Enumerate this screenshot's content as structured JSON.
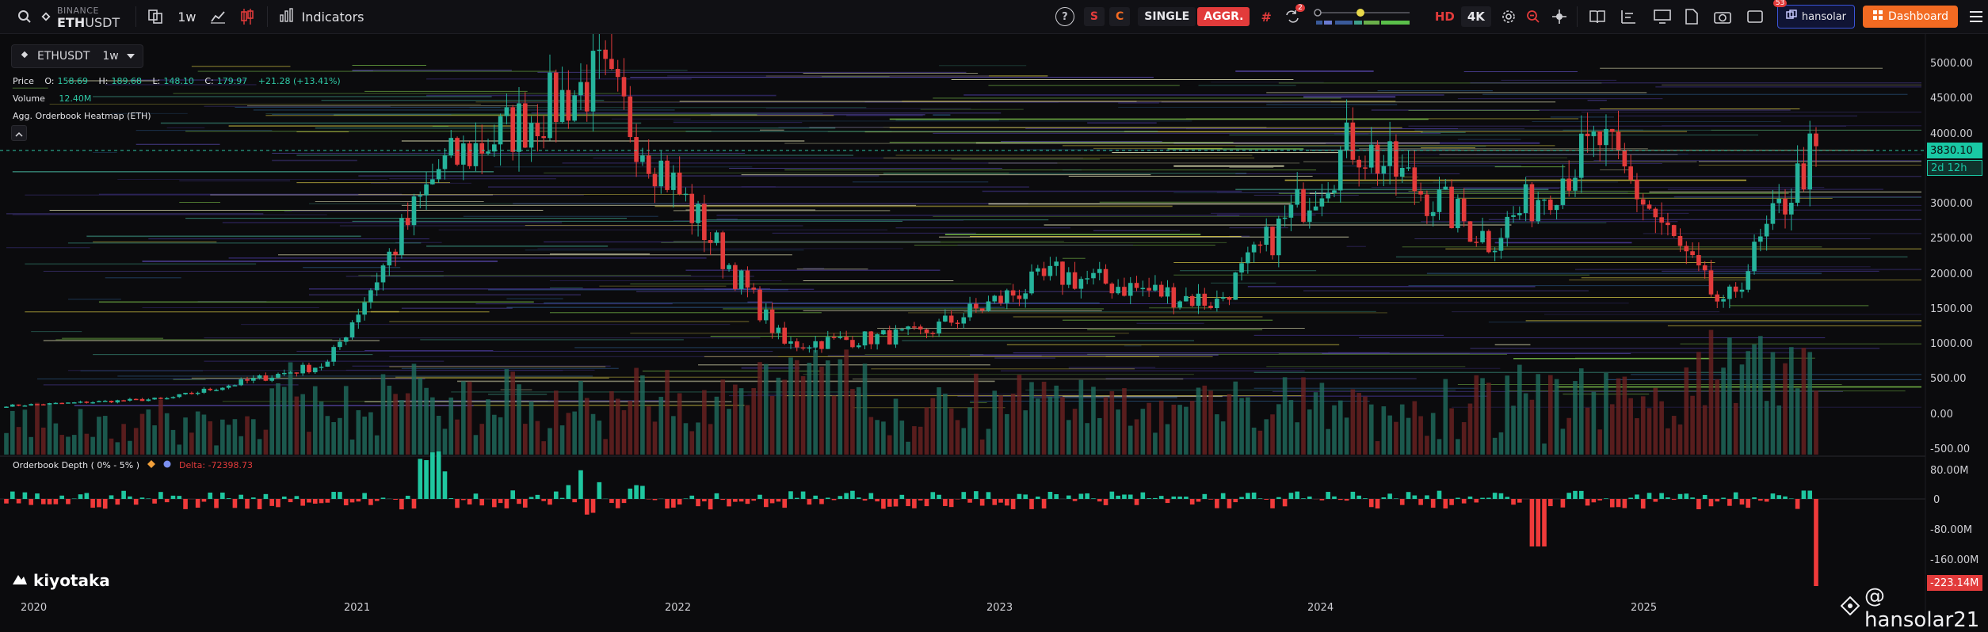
{
  "topbar": {
    "exchange": "BINANCE",
    "symbol_base": "ETH",
    "symbol_quote": "USDT",
    "timeframe": "1w",
    "indicators_label": "Indicators",
    "help_label": "?",
    "s_label": "S",
    "c_label": "C",
    "single_label": "SINGLE",
    "aggr_label": "AGGR.",
    "hash_label": "#",
    "alert_badge": "2",
    "hd_label": "HD",
    "k4_label": "4K",
    "user_badge": "53",
    "user_label": "hansolar",
    "dashboard_label": "Dashboard"
  },
  "legend": {
    "symbol": "ETHUSDT",
    "timeframe": "1w",
    "price_label": "Price",
    "o_key": "O:",
    "o": "158.69",
    "h_key": "H:",
    "h": "189.68",
    "l_key": "L:",
    "l": "148.10",
    "c_key": "C:",
    "c": "179.97",
    "change": "+21.28 (+13.41%)",
    "volume_label": "Volume",
    "volume": "12.40M",
    "heatmap_label": "Agg. Orderbook Heatmap (ETH)",
    "collapse": "^"
  },
  "price_axis": [
    "5000.00",
    "4500.00",
    "4000.00",
    "3500.00",
    "3000.00",
    "2500.00",
    "2000.00",
    "1500.00",
    "1000.00",
    "500.00",
    "0.00",
    "-500.00"
  ],
  "current_price": "3830.10",
  "countdown": "2d 12h",
  "depth": {
    "label": "Orderbook Depth ( 0% - 5% )",
    "delta": "Delta: -72398.73",
    "axis": [
      "80.00M",
      "0",
      "-80.00M",
      "-160.00M"
    ],
    "current": "-223.14M"
  },
  "years": [
    "2020",
    "2021",
    "2022",
    "2023",
    "2024",
    "2025"
  ],
  "brand": "kiyotaka",
  "watermark": "@ hansolar21",
  "colors": {
    "up": "#26b39b",
    "down": "#e23b3b",
    "accent": "#f26a22",
    "dashboard": "#f26a22"
  },
  "chart_data": {
    "type": "line",
    "x": [
      "2020-01",
      "2020-07",
      "2021-01",
      "2021-05",
      "2021-11",
      "2022-06",
      "2022-11",
      "2023-04",
      "2023-10",
      "2024-03",
      "2024-08",
      "2024-12",
      "2025-04",
      "2025-08"
    ],
    "series": [
      {
        "values": [
          130,
          230,
          730,
          3500,
          4800,
          1000,
          1150,
          2000,
          1600,
          3900,
          2500,
          3900,
          1500,
          3830
        ]
      }
    ],
    "ylim": [
      -500,
      5300
    ]
  }
}
